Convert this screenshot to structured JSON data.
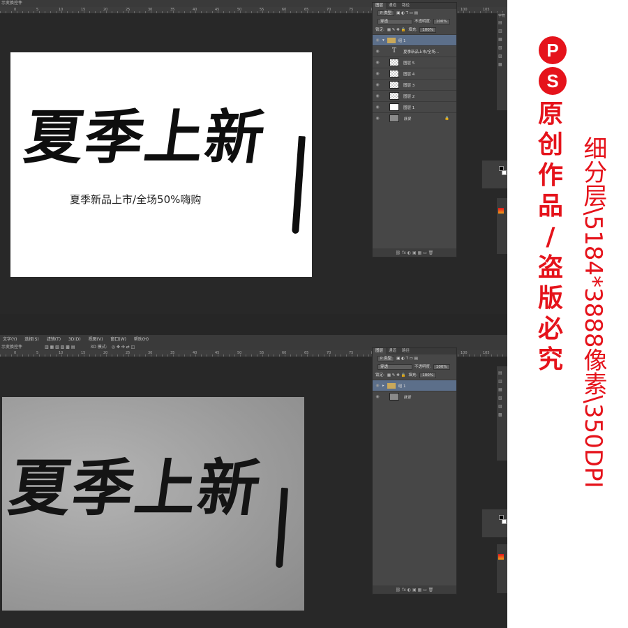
{
  "top_screen": {
    "option_bar_text": "示变换控件",
    "ruler_ticks": [
      "0",
      "5",
      "10",
      "15",
      "20",
      "25",
      "30",
      "35",
      "40",
      "45",
      "50",
      "55",
      "60",
      "65",
      "70",
      "75",
      "80",
      "85",
      "90",
      "95",
      "100",
      "105"
    ],
    "canvas": {
      "calligraphy": "夏季上新",
      "subtitle": "夏季新品上市/全场50%嗨购"
    },
    "layers_panel": {
      "tabs": [
        "图层",
        "通道",
        "路径"
      ],
      "filter_label": "P 类型",
      "blend_mode": "穿透",
      "opacity_label": "不透明度:",
      "opacity_value": "100%",
      "lock_label": "锁定:",
      "fill_label": "填充:",
      "fill_value": "100%",
      "layers": [
        {
          "name": "组 1"
        },
        {
          "name": "夏季新品上市/全场..."
        },
        {
          "name": "图层 5"
        },
        {
          "name": "图层 4"
        },
        {
          "name": "图层 3"
        },
        {
          "name": "图层 2"
        },
        {
          "name": "图层 1"
        },
        {
          "name": "背景"
        }
      ],
      "footer_icons": "⛓ fx ◐ ▣ ▦ ▭ 🗑"
    },
    "side_panel_title": "字符"
  },
  "bottom_screen": {
    "menu": [
      "文字(Y)",
      "选择(S)",
      "滤镜(T)",
      "3D(D)",
      "视图(V)",
      "窗口(W)",
      "帮助(H)"
    ],
    "option_bar_text": "示变换控件",
    "mode_label": "3D 模式:",
    "ruler_ticks": [
      "0",
      "5",
      "10",
      "15",
      "20",
      "25",
      "30",
      "35",
      "40",
      "45",
      "50",
      "55",
      "60",
      "65",
      "70",
      "75",
      "80",
      "85",
      "90",
      "95",
      "100",
      "105"
    ],
    "canvas": {
      "calligraphy": "夏季上新"
    },
    "layers_panel": {
      "tabs": [
        "图层",
        "通道",
        "路径"
      ],
      "filter_label": "P 类型",
      "blend_mode": "穿透",
      "opacity_label": "不透明度:",
      "opacity_value": "100%",
      "lock_label": "锁定:",
      "fill_label": "填充:",
      "fill_value": "100%",
      "layers": [
        {
          "name": "组 1"
        },
        {
          "name": "背景"
        }
      ],
      "footer_icons": "⛓ fx ◐ ▣ ▦ ▭ 🗑"
    }
  },
  "promo": {
    "logo_letters": [
      "P",
      "S"
    ],
    "main_text": [
      "原",
      "创",
      "作",
      "品",
      "/",
      "盗",
      "版",
      "必",
      "究"
    ],
    "spec_text": "细分层\\5184*3888像素\\350DPI",
    "accent_color": "#e5131b"
  }
}
